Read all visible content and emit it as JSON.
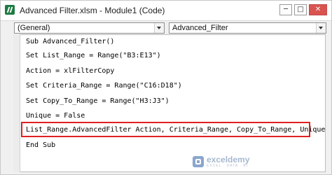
{
  "window": {
    "title": "Advanced Filter.xlsm - Module1 (Code)",
    "controls": {
      "minimize": "─",
      "maximize": "□",
      "close": "✕"
    }
  },
  "toolbar": {
    "object_combo": "(General)",
    "procedure_combo": "Advanced_Filter"
  },
  "code": {
    "lines": [
      "Sub Advanced_Filter()",
      "Set List_Range = Range(\"B3:E13\")",
      "Action = xlFilterCopy",
      "Set Criteria_Range = Range(\"C16:D18\")",
      "Set Copy_To_Range = Range(\"H3:J3\")",
      "Unique = False",
      "List_Range.AdvancedFilter Action, Criteria_Range, Copy_To_Range, Unique",
      "End Sub"
    ],
    "highlighted_line_index": 6
  },
  "watermark": {
    "name": "exceldemy",
    "tagline": "EXCEL · DATA · BI"
  },
  "colors": {
    "highlight": "#e02020",
    "excel_green": "#1e7b43"
  }
}
